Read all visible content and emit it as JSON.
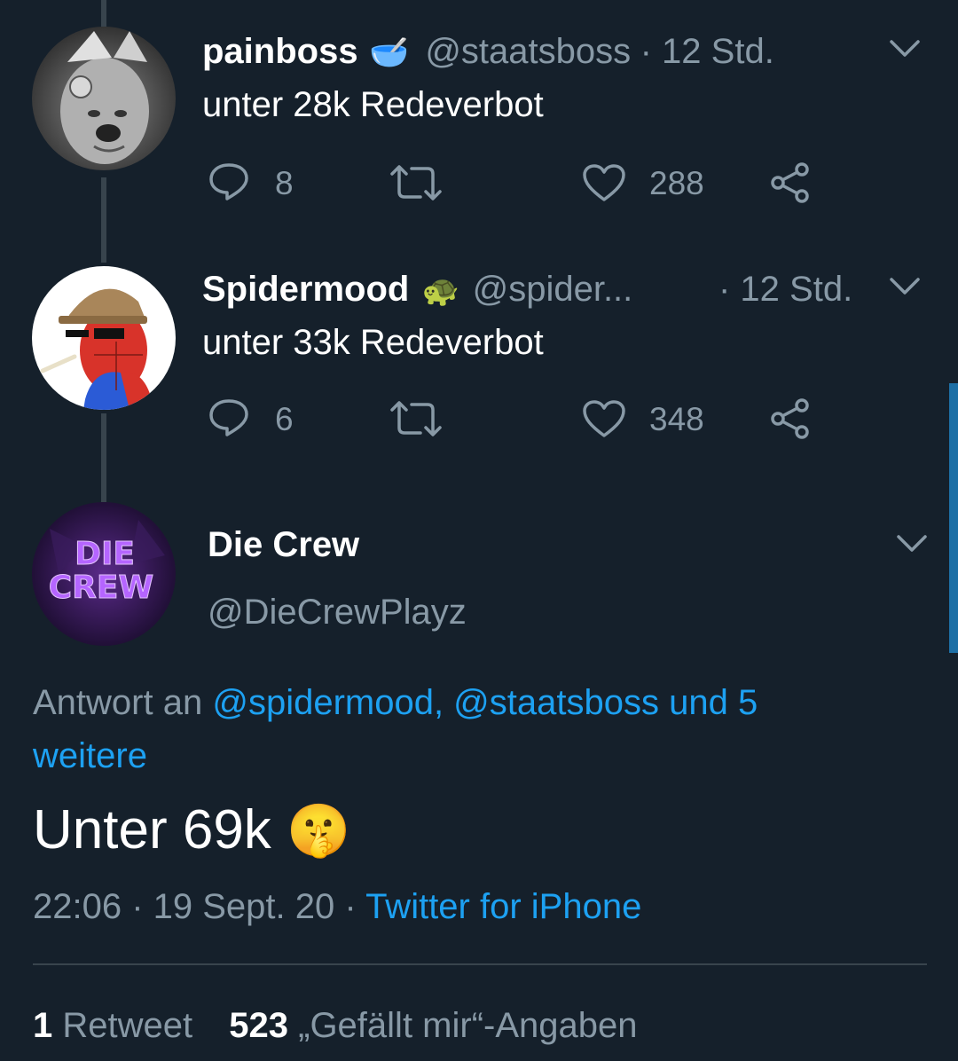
{
  "tweets": [
    {
      "display_name": "painboss",
      "name_emoji": "🥣",
      "handle": "@staatsboss",
      "time": "· 12 Std.",
      "text": "unter 28k Redeverbot",
      "replies": "8",
      "retweets": "",
      "likes": "288"
    },
    {
      "display_name": "Spidermood",
      "name_emoji": "🐢",
      "handle": "@spider...",
      "time": "· 12 Std.",
      "text": "unter 33k Redeverbot",
      "replies": "6",
      "retweets": "",
      "likes": "348"
    }
  ],
  "main_tweet": {
    "display_name": "Die Crew",
    "handle": "@DieCrewPlayz",
    "reply_prefix": "Antwort an",
    "reply_mentions": "@spidermood, @staatsboss und 5",
    "reply_more": "weitere",
    "text": "Unter 69k",
    "emoji": "🤫",
    "timestamp": "22:06 · 19 Sept. 20 ·",
    "source": "Twitter for iPhone",
    "retweet_count": "1",
    "retweet_label": "Retweet",
    "like_count": "523",
    "like_label": "„Gefällt mir“-Angaben"
  },
  "avatar_text": {
    "main_logo_line1": "DIE",
    "main_logo_line2": "CREW"
  },
  "colors": {
    "background": "#15202b",
    "secondary_text": "#8899a6",
    "link": "#1da1f2",
    "divider": "#38444d",
    "scrollbar": "#1d6fa5"
  }
}
